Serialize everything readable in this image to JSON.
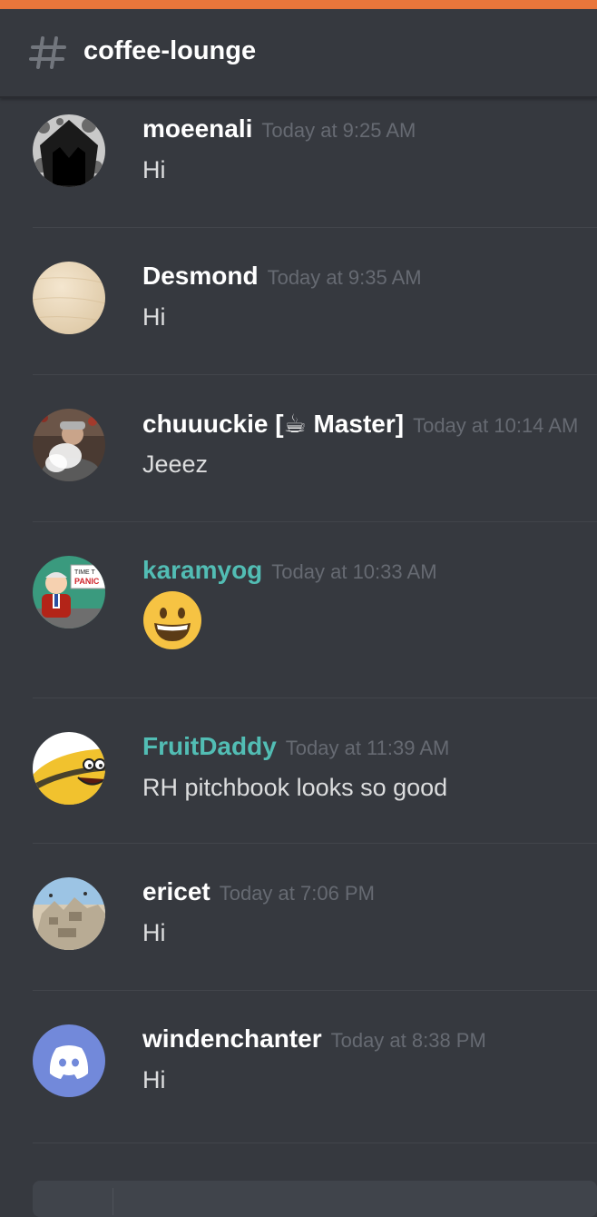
{
  "channel": {
    "name": "coffee-lounge"
  },
  "messages": [
    {
      "username": "moeenali",
      "timestamp": "Today at 9:25 AM",
      "text": "Hi"
    },
    {
      "username": "Desmond",
      "timestamp": "Today at 9:35 AM",
      "text": "Hi"
    },
    {
      "username_pre": "chuuuckie [",
      "username_emoji": "☕",
      "username_post": " Master]",
      "timestamp": "Today at 10:14 AM",
      "text": "Jeeez"
    },
    {
      "username": "karamyog",
      "timestamp": "Today at 10:33 AM",
      "emoji": "grinning-face",
      "avatar_sign_line1": "TIME T",
      "avatar_sign_line2": "PANIC"
    },
    {
      "username": "FruitDaddy",
      "timestamp": "Today at 11:39 AM",
      "text": "RH pitchbook looks so good"
    },
    {
      "username": "ericet",
      "timestamp": "Today at 7:06 PM",
      "text": "Hi"
    },
    {
      "username": "windenchanter",
      "timestamp": "Today at 8:38 PM",
      "text": "Hi"
    }
  ],
  "colors": {
    "accent_bar": "#e9763b",
    "background": "#36393f",
    "role_teal": "#52bdb4",
    "discord_blurple": "#7289da"
  },
  "icons": [
    "hash-icon",
    "coffee-emoji",
    "grinning-face-emoji",
    "discord-logo-icon"
  ]
}
